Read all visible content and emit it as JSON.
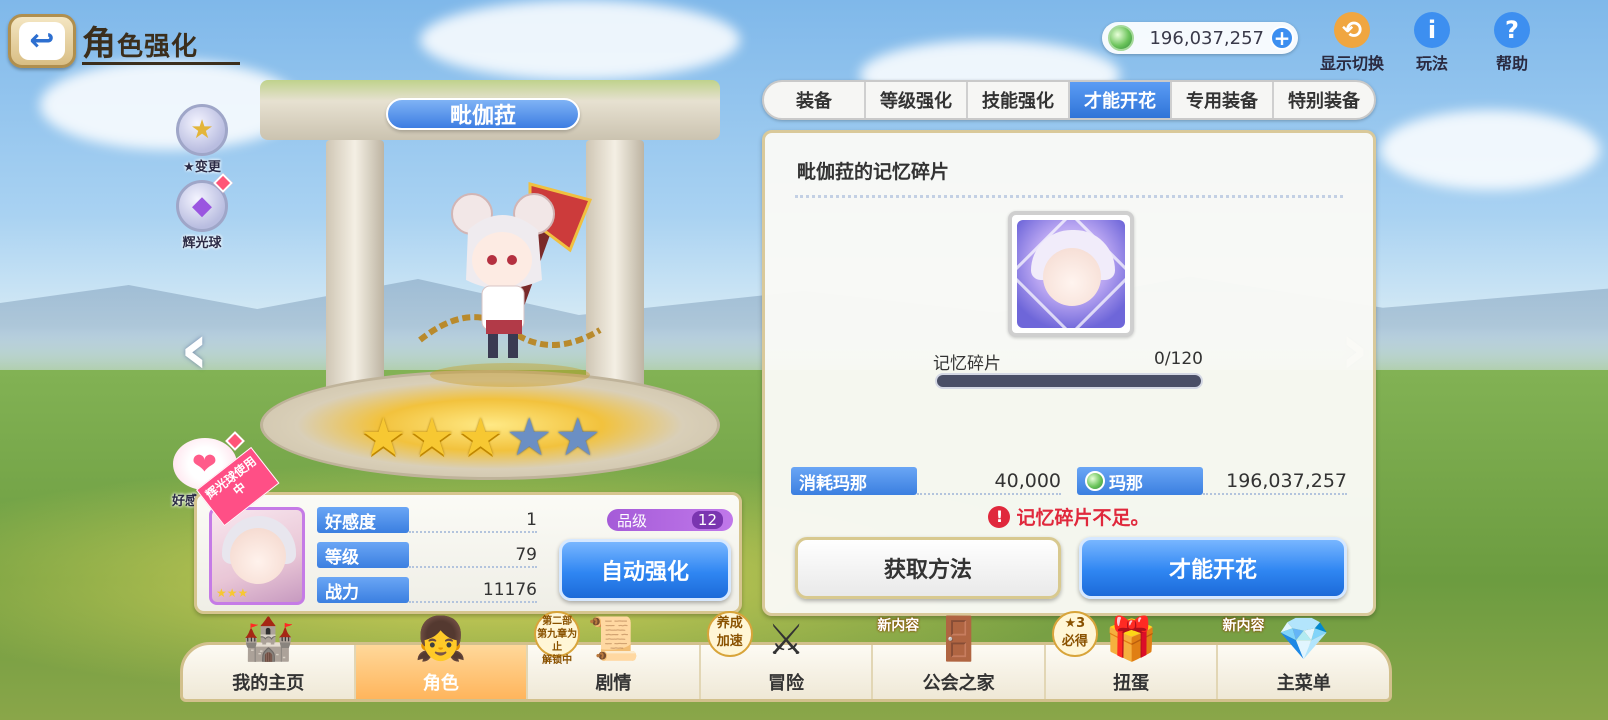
{
  "header": {
    "title_first": "角",
    "title_rest": "色强化",
    "back_icon": "back-arrow-icon"
  },
  "currency": {
    "amount": "196,037,257",
    "icon": "mana-coin-icon",
    "plus_icon": "plus-icon"
  },
  "top_icons": [
    {
      "label": "显示切换",
      "icon": "display-toggle-icon"
    },
    {
      "label": "玩法",
      "icon": "info-icon"
    },
    {
      "label": "帮助",
      "icon": "help-icon"
    }
  ],
  "side_buttons": [
    {
      "label": "★变更",
      "icon": "star-change-icon"
    },
    {
      "label": "辉光球",
      "icon": "glow-orb-icon"
    }
  ],
  "character": {
    "name": "毗伽菈",
    "stars_on": 3,
    "stars_total": 5
  },
  "affection_button": {
    "label": "好感度剧情",
    "icon": "hearts-icon"
  },
  "stats": {
    "ribbon": "辉光球使用中",
    "rows": [
      {
        "label": "好感度",
        "value": "1"
      },
      {
        "label": "等级",
        "value": "79"
      },
      {
        "label": "战力",
        "value": "11176"
      }
    ],
    "rank_label": "品级",
    "rank_value": "12",
    "auto_button": "自动强化"
  },
  "tabs": [
    {
      "label": "装备",
      "active": false
    },
    {
      "label": "等级强化",
      "active": false
    },
    {
      "label": "技能强化",
      "active": false
    },
    {
      "label": "才能开花",
      "active": true
    },
    {
      "label": "专用装备",
      "active": false
    },
    {
      "label": "特别装备",
      "active": false
    }
  ],
  "panel": {
    "title": "毗伽菈的记忆碎片",
    "progress_label": "记忆碎片",
    "progress_count": "0/120",
    "progress_fraction": 0,
    "cost_label": "消耗玛那",
    "cost_value": "40,000",
    "mana_label": "玛那",
    "mana_value": "196,037,257",
    "warning": "记忆碎片不足。",
    "obtain_button": "获取方法",
    "bloom_button": "才能开花"
  },
  "bottom_nav": [
    {
      "label": "我的主页",
      "icon": "castle-icon",
      "active": false,
      "tag": ""
    },
    {
      "label": "角色",
      "icon": "character-icon",
      "active": true,
      "tag": ""
    },
    {
      "label": "剧情",
      "icon": "scroll-icon",
      "active": false,
      "tag": ""
    },
    {
      "label": "冒险",
      "icon": "sword-icon",
      "active": false,
      "tag": ""
    },
    {
      "label": "公会之家",
      "icon": "guild-door-icon",
      "active": false,
      "tag": "新内容"
    },
    {
      "label": "扭蛋",
      "icon": "gacha-icon",
      "active": false,
      "tag": ""
    },
    {
      "label": "主菜单",
      "icon": "crystal-icon",
      "active": false,
      "tag": "新内容"
    }
  ],
  "nav_badges": {
    "story_badge": "第二部\n第九章为止\n解锁中",
    "adventure_badge": "养成\n加速",
    "gacha_badge": "★3\n必得"
  },
  "colors": {
    "accent_blue": "#2f86f2",
    "warning_red": "#e0283c",
    "star_gold": "#f7c832",
    "rank_purple": "#a55bd8"
  }
}
